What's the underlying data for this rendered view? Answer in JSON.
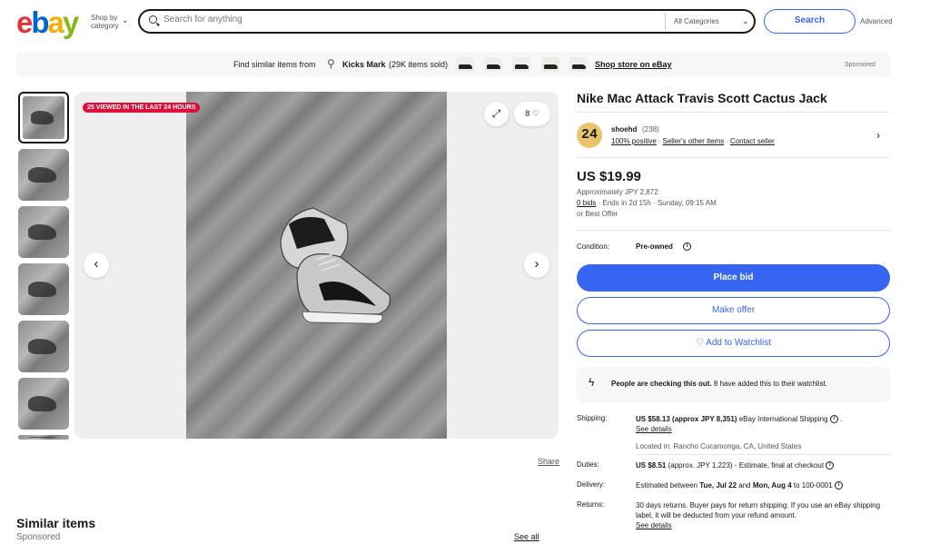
{
  "header": {
    "logo_letters": [
      "e",
      "b",
      "a",
      "y"
    ],
    "shop_by_line1": "Shop by",
    "shop_by_line2": "category",
    "search_placeholder": "Search for anything",
    "category_select": "All Categories",
    "search_button": "Search",
    "advanced_link": "Advanced"
  },
  "store_bar": {
    "prefix": "Find similar items from",
    "store_name": "Kicks Mark",
    "items_sold": "(29K items sold)",
    "shop_store_link": "Shop store on eBay",
    "sponsored": "Sponsored"
  },
  "gallery": {
    "viewed_badge": "25 VIEWED IN THE LAST 24 HOURS",
    "watch_count": "8",
    "share": "Share"
  },
  "similar": {
    "title": "Similar items",
    "sponsored": "Sponsored",
    "see_all": "See all"
  },
  "listing": {
    "title": "Nike Mac Attack Travis Scott Cactus Jack",
    "seller": {
      "avatar_text": "24",
      "name": "shoehd",
      "feedback_count": "(238)",
      "positive": "100% positive",
      "other_items": "Seller's other items",
      "contact": "Contact seller"
    },
    "price": "US $19.99",
    "approx": "Approximately JPY 2,872",
    "bids_link": "0 bids",
    "ends": "· Ends in 2d 15h · Sunday, 09:15 AM",
    "best_offer": "or Best Offer",
    "condition_label": "Condition:",
    "condition_value": "Pre-owned",
    "place_bid": "Place bid",
    "make_offer": "Make offer",
    "add_watchlist": "♡ Add to Watchlist",
    "alert_bold": "People are checking this out.",
    "alert_rest": " 8 have added this to their watchlist."
  },
  "details": {
    "shipping_label": "Shipping:",
    "shipping_bold": "US $58.13 (approx JPY 8,351)",
    "shipping_rest": " eBay International Shipping",
    "shipping_see": "See details",
    "located": "Located in: Rancho Cucamonga, CA, United States",
    "duties_label": "Duties:",
    "duties_bold": "US $8.51",
    "duties_rest": " (approx. JPY 1,223) - Estimate, final at checkout",
    "delivery_label": "Delivery:",
    "delivery_pre": "Estimated between ",
    "delivery_d1": "Tue, Jul 22",
    "delivery_and": " and ",
    "delivery_d2": "Mon, Aug 4",
    "delivery_post": " to 100-0001",
    "returns_label": "Returns:",
    "returns_text": "30 days returns. Buyer pays for return shipping. If you use an eBay shipping label, it will be deducted from your refund amount.",
    "returns_see": "See details"
  },
  "colors": {
    "primary": "#3665f3",
    "badge_red": "#e0103a"
  }
}
